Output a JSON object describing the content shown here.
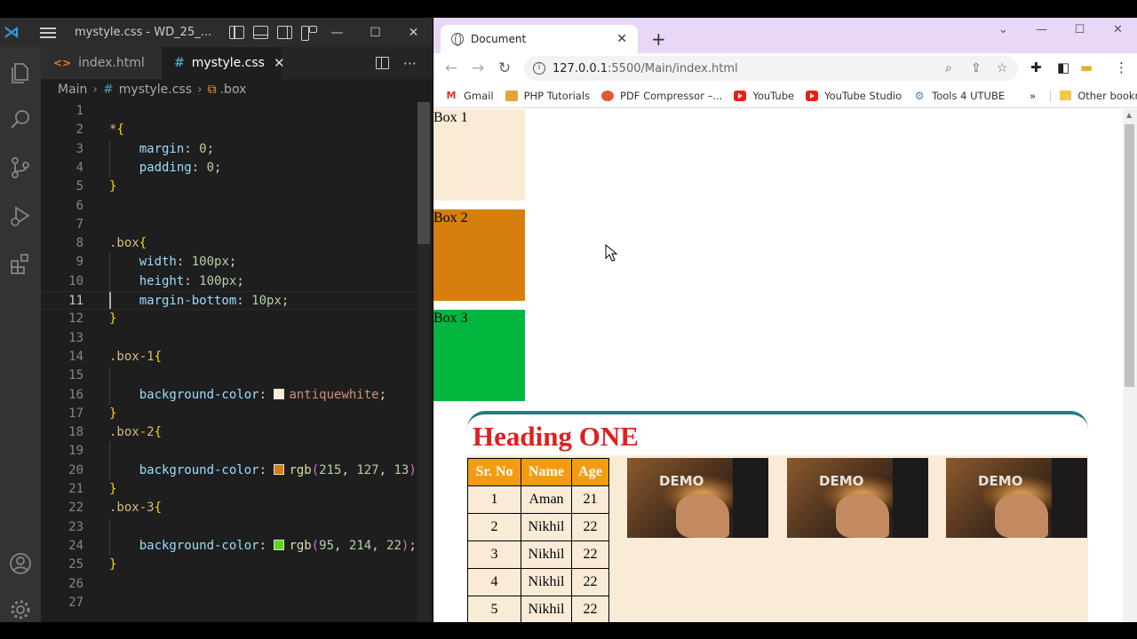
{
  "vscode": {
    "title": "mystyle.css - WD_25_...",
    "tabs": [
      {
        "label": "index.html",
        "active": false
      },
      {
        "label": "mystyle.css",
        "active": true
      }
    ],
    "breadcrumb": [
      "Main",
      "mystyle.css",
      ".box"
    ],
    "current_line": 11,
    "code_lines": [
      {
        "n": "1",
        "text": ""
      },
      {
        "n": "2",
        "text": "*{"
      },
      {
        "n": "3",
        "text": "    margin: 0;"
      },
      {
        "n": "4",
        "text": "    padding: 0;"
      },
      {
        "n": "5",
        "text": "}"
      },
      {
        "n": "6",
        "text": ""
      },
      {
        "n": "7",
        "text": ""
      },
      {
        "n": "8",
        "text": ".box{"
      },
      {
        "n": "9",
        "text": "    width: 100px;"
      },
      {
        "n": "10",
        "text": "    height: 100px;"
      },
      {
        "n": "11",
        "text": "    margin-bottom: 10px;"
      },
      {
        "n": "12",
        "text": "}"
      },
      {
        "n": "13",
        "text": ""
      },
      {
        "n": "14",
        "text": ".box-1{"
      },
      {
        "n": "15",
        "text": ""
      },
      {
        "n": "16",
        "text": "    background-color: antiquewhite;"
      },
      {
        "n": "17",
        "text": "}"
      },
      {
        "n": "18",
        "text": ".box-2{"
      },
      {
        "n": "19",
        "text": ""
      },
      {
        "n": "20",
        "text": "    background-color: rgb(215, 127, 13);"
      },
      {
        "n": "21",
        "text": "}"
      },
      {
        "n": "22",
        "text": ".box-3{"
      },
      {
        "n": "23",
        "text": ""
      },
      {
        "n": "24",
        "text": "    background-color: rgb(95, 214, 22);"
      },
      {
        "n": "25",
        "text": "}"
      },
      {
        "n": "26",
        "text": ""
      },
      {
        "n": "27",
        "text": ""
      }
    ],
    "swatches": {
      "antiquewhite": "#faebd7",
      "box2": "#d77f0d",
      "box3": "#5fd616"
    }
  },
  "chrome": {
    "tab_title": "Document",
    "url_host": "127.0.0.1",
    "url_path": ":5500/Main/index.html",
    "bookmarks": [
      {
        "label": "Gmail",
        "icon": "gmail-icon"
      },
      {
        "label": "PHP Tutorials",
        "icon": "php-icon"
      },
      {
        "label": "PDF Compressor –...",
        "icon": "pdf-icon"
      },
      {
        "label": "YouTube",
        "icon": "youtube-icon"
      },
      {
        "label": "YouTube Studio",
        "icon": "youtube-icon"
      },
      {
        "label": "Tools 4 UTUBE",
        "icon": "tools-icon"
      }
    ],
    "more_bookmarks": "»",
    "other_bookmarks": "Other bookmarks"
  },
  "page": {
    "boxes": [
      "Box 1",
      "Box 2",
      "Box 3"
    ],
    "heading": "Heading ONE",
    "table": {
      "headers": [
        "Sr. No",
        "Name",
        "Age"
      ],
      "rows": [
        [
          "1",
          "Aman",
          "21"
        ],
        [
          "2",
          "Nikhil",
          "22"
        ],
        [
          "3",
          "Nikhil",
          "22"
        ],
        [
          "4",
          "Nikhil",
          "22"
        ],
        [
          "5",
          "Nikhil",
          "22"
        ]
      ]
    },
    "image_caption": "DEMO",
    "colors": {
      "heading": "#e02020",
      "table_header": "#f39c12",
      "section_border": "#1f8080",
      "box1": "#faebd7",
      "box2": "#d77f0d",
      "box3": "#03b73e"
    }
  }
}
